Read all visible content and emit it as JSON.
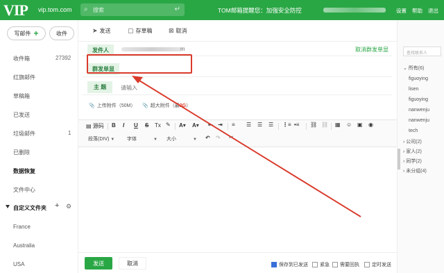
{
  "header": {
    "logo": "VIP",
    "domain": "vip.tom.com",
    "search_placeholder": "搜索",
    "notice": "TOM邮箱提醒您：加强安全防控",
    "links": [
      "设置",
      "帮助",
      "退出"
    ],
    "accent": "#2aa745"
  },
  "sidebar": {
    "compose": "写邮件",
    "receive": "收件",
    "items": [
      {
        "label": "收件箱",
        "count": "27392"
      },
      {
        "label": "红旗邮件",
        "count": ""
      },
      {
        "label": "草稿箱",
        "count": ""
      },
      {
        "label": "已发送",
        "count": ""
      },
      {
        "label": "垃圾邮件",
        "count": "1"
      },
      {
        "label": "已删除",
        "count": ""
      },
      {
        "label": "数据恢复",
        "count": ""
      },
      {
        "label": "文件中心",
        "count": ""
      }
    ],
    "custom_folders": "自定义文件夹",
    "folders": [
      "France",
      "Australia",
      "USA"
    ]
  },
  "toolbar": {
    "send": "发送",
    "save_draft": "存草稿",
    "cancel": "取消"
  },
  "compose": {
    "sender_label": "发件人",
    "sender_tail": "m",
    "cancel_mass": "取消群发单显",
    "mass_label": "群发单显",
    "subject_label": "主 题",
    "subject_placeholder": "请输入",
    "attach": "上传附件（50M）",
    "big_attach_prefix": "超大附件（最",
    "big_attach_highlight": "2G",
    "big_attach_suffix": "）"
  },
  "editor": {
    "source": "源码",
    "buttons": [
      "B",
      "I",
      "U",
      "S",
      "Tx"
    ],
    "paragraph": "段落(DIV)",
    "font": "字体",
    "size": "大小"
  },
  "bottom": {
    "send": "发送",
    "cancel": "取消",
    "options": [
      {
        "label": "保存到已发送",
        "checked": true
      },
      {
        "label": "紧急",
        "checked": false
      },
      {
        "label": "需要回执",
        "checked": false
      },
      {
        "label": "定时发送",
        "checked": false
      }
    ]
  },
  "contacts": {
    "search_placeholder": "查找联系人",
    "all": "所有(6)",
    "names": [
      "figuoying",
      "lisen",
      "figuoying",
      "nanwenju",
      "nanwenju",
      "tech"
    ],
    "groups": [
      "公司(2)",
      "家人(2)",
      "同学(2)",
      "未分组(4)"
    ]
  },
  "annotation_color": "#d93a2b"
}
